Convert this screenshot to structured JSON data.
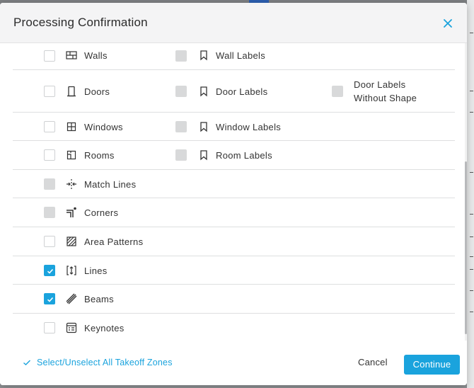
{
  "dialog": {
    "title": "Processing Confirmation"
  },
  "rows": [
    {
      "label": "Walls",
      "icon": "wall-icon",
      "state": "unchecked",
      "sub": [
        {
          "label": "Wall Labels",
          "icon": "bookmark-icon",
          "state": "disabled"
        }
      ]
    },
    {
      "label": "Doors",
      "icon": "door-icon",
      "state": "unchecked",
      "sub": [
        {
          "label": "Door Labels",
          "icon": "bookmark-icon",
          "state": "disabled"
        }
      ],
      "extra": {
        "label": "Door Labels Without Shape",
        "state": "disabled"
      }
    },
    {
      "label": "Windows",
      "icon": "window-icon",
      "state": "unchecked",
      "sub": [
        {
          "label": "Window Labels",
          "icon": "bookmark-icon",
          "state": "disabled"
        }
      ]
    },
    {
      "label": "Rooms",
      "icon": "room-icon",
      "state": "unchecked",
      "sub": [
        {
          "label": "Room Labels",
          "icon": "bookmark-icon",
          "state": "disabled"
        }
      ]
    },
    {
      "label": "Match Lines",
      "icon": "match-lines-icon",
      "state": "disabled"
    },
    {
      "label": "Corners",
      "icon": "corner-icon",
      "state": "disabled"
    },
    {
      "label": "Area Patterns",
      "icon": "area-pattern-icon",
      "state": "unchecked"
    },
    {
      "label": "Lines",
      "icon": "lines-icon",
      "state": "checked"
    },
    {
      "label": "Beams",
      "icon": "beams-icon",
      "state": "checked"
    },
    {
      "label": "Keynotes",
      "icon": "keynotes-icon",
      "state": "unchecked"
    }
  ],
  "footer": {
    "select_all_label": "Select/Unselect All Takeoff Zones",
    "cancel_label": "Cancel",
    "continue_label": "Continue"
  },
  "colors": {
    "accent": "#1aa3dd",
    "disabled": "#d8d9da"
  }
}
